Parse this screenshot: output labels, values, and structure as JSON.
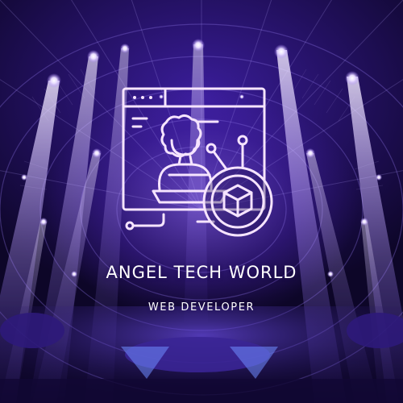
{
  "brand": {
    "name": "ANGEL TECH WORLD",
    "tagline": "WEB DEVELOPER"
  },
  "icons": {
    "logo": "web-developer-icon",
    "cube": "cube-icon"
  },
  "colors": {
    "beam": "#e9dcff",
    "glow": "#a07bff",
    "logo_line": "#f6e4ff",
    "text": "#ffffff",
    "deep": "#0a0420"
  }
}
